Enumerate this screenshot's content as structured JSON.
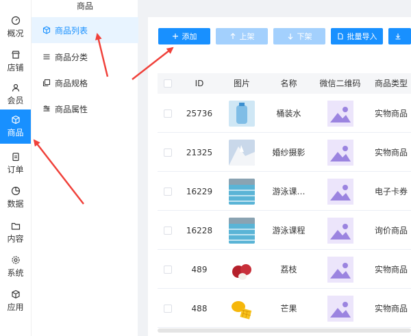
{
  "primary_nav": [
    {
      "label": "概况",
      "icon": "dashboard-icon"
    },
    {
      "label": "店铺",
      "icon": "store-icon"
    },
    {
      "label": "会员",
      "icon": "user-icon"
    },
    {
      "label": "商品",
      "icon": "cube-icon",
      "active": true
    },
    {
      "label": "订单",
      "icon": "clipboard-icon"
    },
    {
      "label": "数据",
      "icon": "pie-chart-icon"
    },
    {
      "label": "内容",
      "icon": "folder-icon"
    },
    {
      "label": "系统",
      "icon": "gear-icon"
    },
    {
      "label": "应用",
      "icon": "cube-outline-icon"
    }
  ],
  "sub_nav": {
    "title": "商品",
    "items": [
      {
        "label": "商品列表",
        "icon": "cube-icon",
        "active": true
      },
      {
        "label": "商品分类",
        "icon": "list-icon"
      },
      {
        "label": "商品规格",
        "icon": "copy-icon"
      },
      {
        "label": "商品属性",
        "icon": "sliders-icon"
      }
    ]
  },
  "toolbar": {
    "add": "添加",
    "shelf_up": "上架",
    "shelf_down": "下架",
    "batch_import": "批量导入"
  },
  "table": {
    "headers": [
      "ID",
      "图片",
      "名称",
      "微信二维码",
      "商品类型"
    ],
    "rows": [
      {
        "id": "25736",
        "name": "桶装水",
        "type": "实物商品",
        "image": "water"
      },
      {
        "id": "21325",
        "name": "婚纱摄影",
        "type": "实物商品",
        "image": "wedding"
      },
      {
        "id": "16229",
        "name": "游泳课…",
        "type": "电子卡券",
        "image": "pool"
      },
      {
        "id": "16228",
        "name": "游泳课程",
        "type": "询价商品",
        "image": "pool"
      },
      {
        "id": "489",
        "name": "荔枝",
        "type": "实物商品",
        "image": "lychee"
      },
      {
        "id": "488",
        "name": "芒果",
        "type": "实物商品",
        "image": "mango"
      }
    ]
  },
  "colors": {
    "accent": "#1890ff",
    "disabled": "#a3d0fd",
    "annotation_arrow": "#f0413a"
  }
}
